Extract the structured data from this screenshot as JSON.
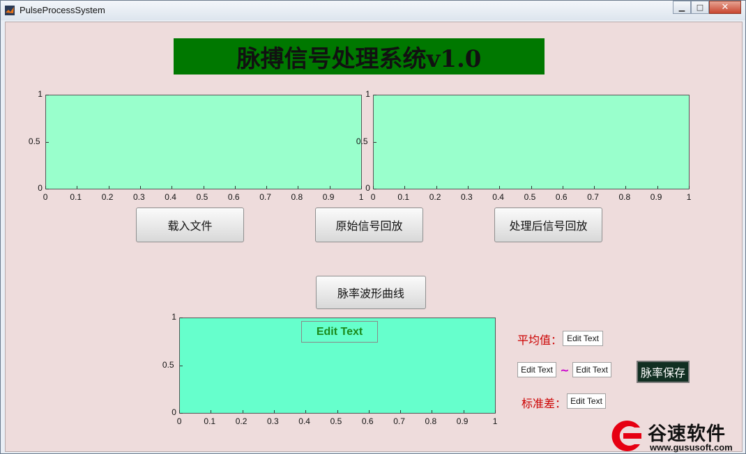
{
  "window": {
    "title": "PulseProcessSystem",
    "minimize_label": "▁",
    "maximize_label": "□",
    "close_label": "✕"
  },
  "banner": {
    "title": "脉搏信号处理系统v1.0",
    "bg": "#007800"
  },
  "axes": [
    {
      "id": "top-left",
      "bg": "#99ffcc",
      "x_ticks": [
        "0",
        "0.1",
        "0.2",
        "0.3",
        "0.4",
        "0.5",
        "0.6",
        "0.7",
        "0.8",
        "0.9",
        "1"
      ],
      "y_ticks": [
        "0",
        "0.5",
        "1"
      ]
    },
    {
      "id": "top-right",
      "bg": "#99ffcc",
      "x_ticks": [
        "0",
        "0.1",
        "0.2",
        "0.3",
        "0.4",
        "0.5",
        "0.6",
        "0.7",
        "0.8",
        "0.9",
        "1"
      ],
      "y_ticks": [
        "0",
        "0.5",
        "1"
      ]
    },
    {
      "id": "bottom",
      "bg": "#66ffcc",
      "x_ticks": [
        "0",
        "0.1",
        "0.2",
        "0.3",
        "0.4",
        "0.5",
        "0.6",
        "0.7",
        "0.8",
        "0.9",
        "1"
      ],
      "y_ticks": [
        "0",
        "0.5",
        "1"
      ]
    }
  ],
  "buttons": {
    "load_file": "载入文件",
    "play_original": "原始信号回放",
    "play_processed": "处理后信号回放",
    "pulse_curve": "脉率波形曲线",
    "save_rate": "脉率保存"
  },
  "stats": {
    "plot_edit": "Edit Text",
    "mean_label": "平均值：",
    "mean_value": "Edit Text",
    "range_min": "Edit Text",
    "range_sep": "~",
    "range_max": "Edit Text",
    "std_label": "标准差：",
    "std_value": "Edit Text"
  },
  "watermark": {
    "brand": "谷速软件",
    "url": "www.gususoft.com"
  }
}
